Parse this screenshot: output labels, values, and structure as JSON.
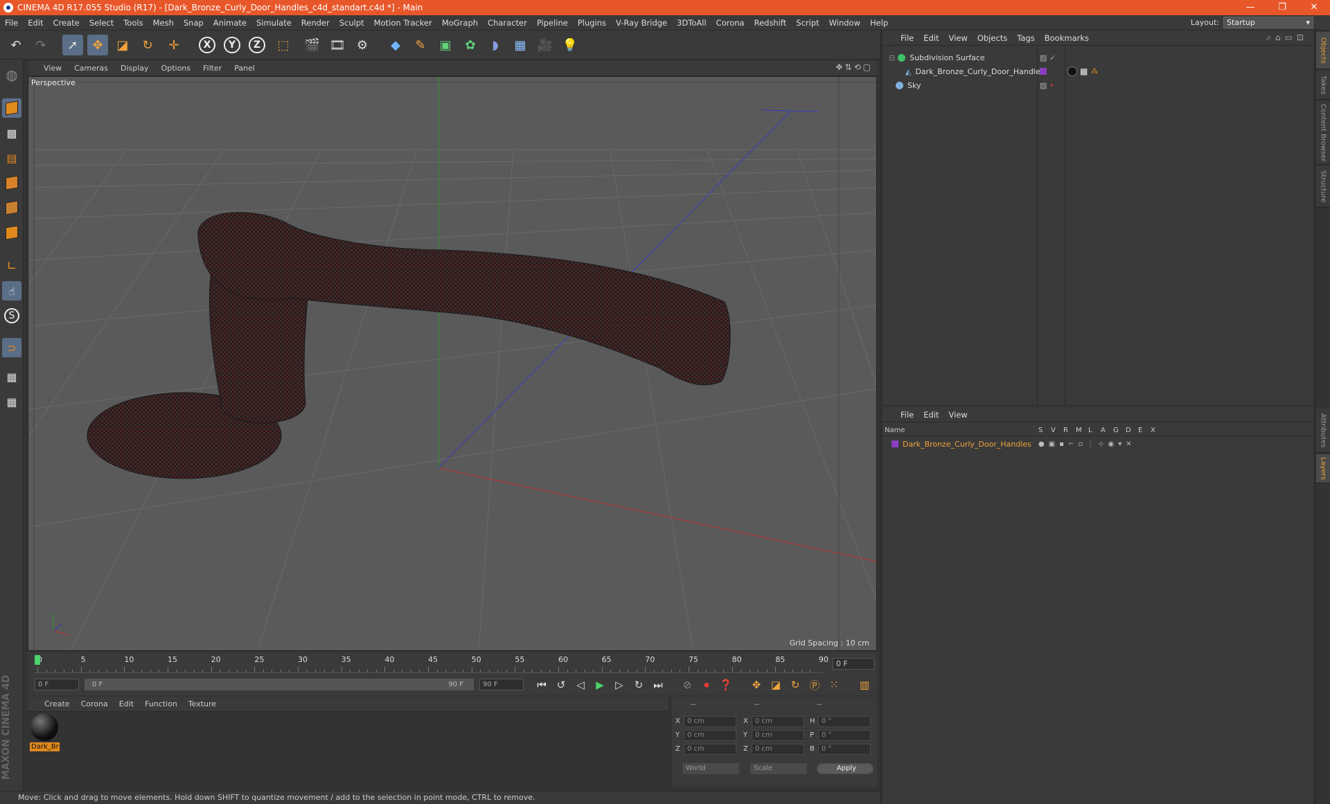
{
  "window": {
    "title": "CINEMA 4D R17.055 Studio (R17) - [Dark_Bronze_Curly_Door_Handles_c4d_standart.c4d *] - Main",
    "minimize": "—",
    "maximize": "❐",
    "close": "✕"
  },
  "menu": [
    "File",
    "Edit",
    "Create",
    "Select",
    "Tools",
    "Mesh",
    "Snap",
    "Animate",
    "Simulate",
    "Render",
    "Sculpt",
    "Motion Tracker",
    "MoGraph",
    "Character",
    "Pipeline",
    "Plugins",
    "V-Ray Bridge",
    "3DToAll",
    "Corona",
    "Redshift",
    "Script",
    "Window",
    "Help"
  ],
  "layout": {
    "label": "Layout:",
    "value": "Startup"
  },
  "toolbar": {
    "axis_x": "X",
    "axis_y": "Y",
    "axis_z": "Z"
  },
  "viewport": {
    "menu": [
      "View",
      "Cameras",
      "Display",
      "Options",
      "Filter",
      "Panel"
    ],
    "label": "Perspective",
    "grid_spacing": "Grid Spacing : 10 cm"
  },
  "timeline": {
    "ticks": [
      "0",
      "5",
      "10",
      "15",
      "20",
      "25",
      "30",
      "35",
      "40",
      "45",
      "50",
      "55",
      "60",
      "65",
      "70",
      "75",
      "80",
      "85",
      "90"
    ],
    "current_frame": "0 F",
    "start_field": "0 F",
    "range_start": "0 F",
    "range_end": "90 F",
    "end_field": "90 F"
  },
  "materials": {
    "menu": [
      "Create",
      "Corona",
      "Edit",
      "Function",
      "Texture"
    ],
    "items": [
      {
        "name": "Dark_Br"
      }
    ]
  },
  "coords": {
    "headers": [
      "--",
      "--",
      "--"
    ],
    "rows": [
      {
        "a": "X",
        "av": "0 cm",
        "b": "X",
        "bv": "0 cm",
        "c": "H",
        "cv": "0 °"
      },
      {
        "a": "Y",
        "av": "0 cm",
        "b": "Y",
        "bv": "0 cm",
        "c": "P",
        "cv": "0 °"
      },
      {
        "a": "Z",
        "av": "0 cm",
        "b": "Z",
        "bv": "0 cm",
        "c": "B",
        "cv": "0 °"
      }
    ],
    "mode1": "World",
    "mode2": "Scale",
    "apply": "Apply"
  },
  "status": "Move: Click and drag to move elements. Hold down SHIFT to quantize movement / add to the selection in point mode, CTRL to remove.",
  "object_manager": {
    "menu": [
      "File",
      "Edit",
      "View",
      "Objects",
      "Tags",
      "Bookmarks"
    ],
    "objects": [
      {
        "name": "Subdivision Surface",
        "color": "#3fbf6a"
      },
      {
        "name": "Dark_Bronze_Curly_Door_Handles",
        "color": "#7fb0e0"
      },
      {
        "name": "Sky",
        "color": "#7fb0e0"
      }
    ]
  },
  "layer_manager": {
    "menu": [
      "File",
      "Edit",
      "View"
    ],
    "columns": [
      "Name",
      "S",
      "V",
      "R",
      "M",
      "L",
      "A",
      "G",
      "D",
      "E",
      "X"
    ],
    "layers": [
      {
        "name": "Dark_Bronze_Curly_Door_Handles",
        "color": "#8a3fbf"
      }
    ]
  },
  "side_tabs": [
    "Objects",
    "Takes",
    "Content Browser",
    "Structure",
    "Attributes",
    "Layers"
  ],
  "brand": "MAXON CINEMA 4D",
  "colors": {
    "accent": "#e8572a",
    "selection": "#e08a1e"
  }
}
